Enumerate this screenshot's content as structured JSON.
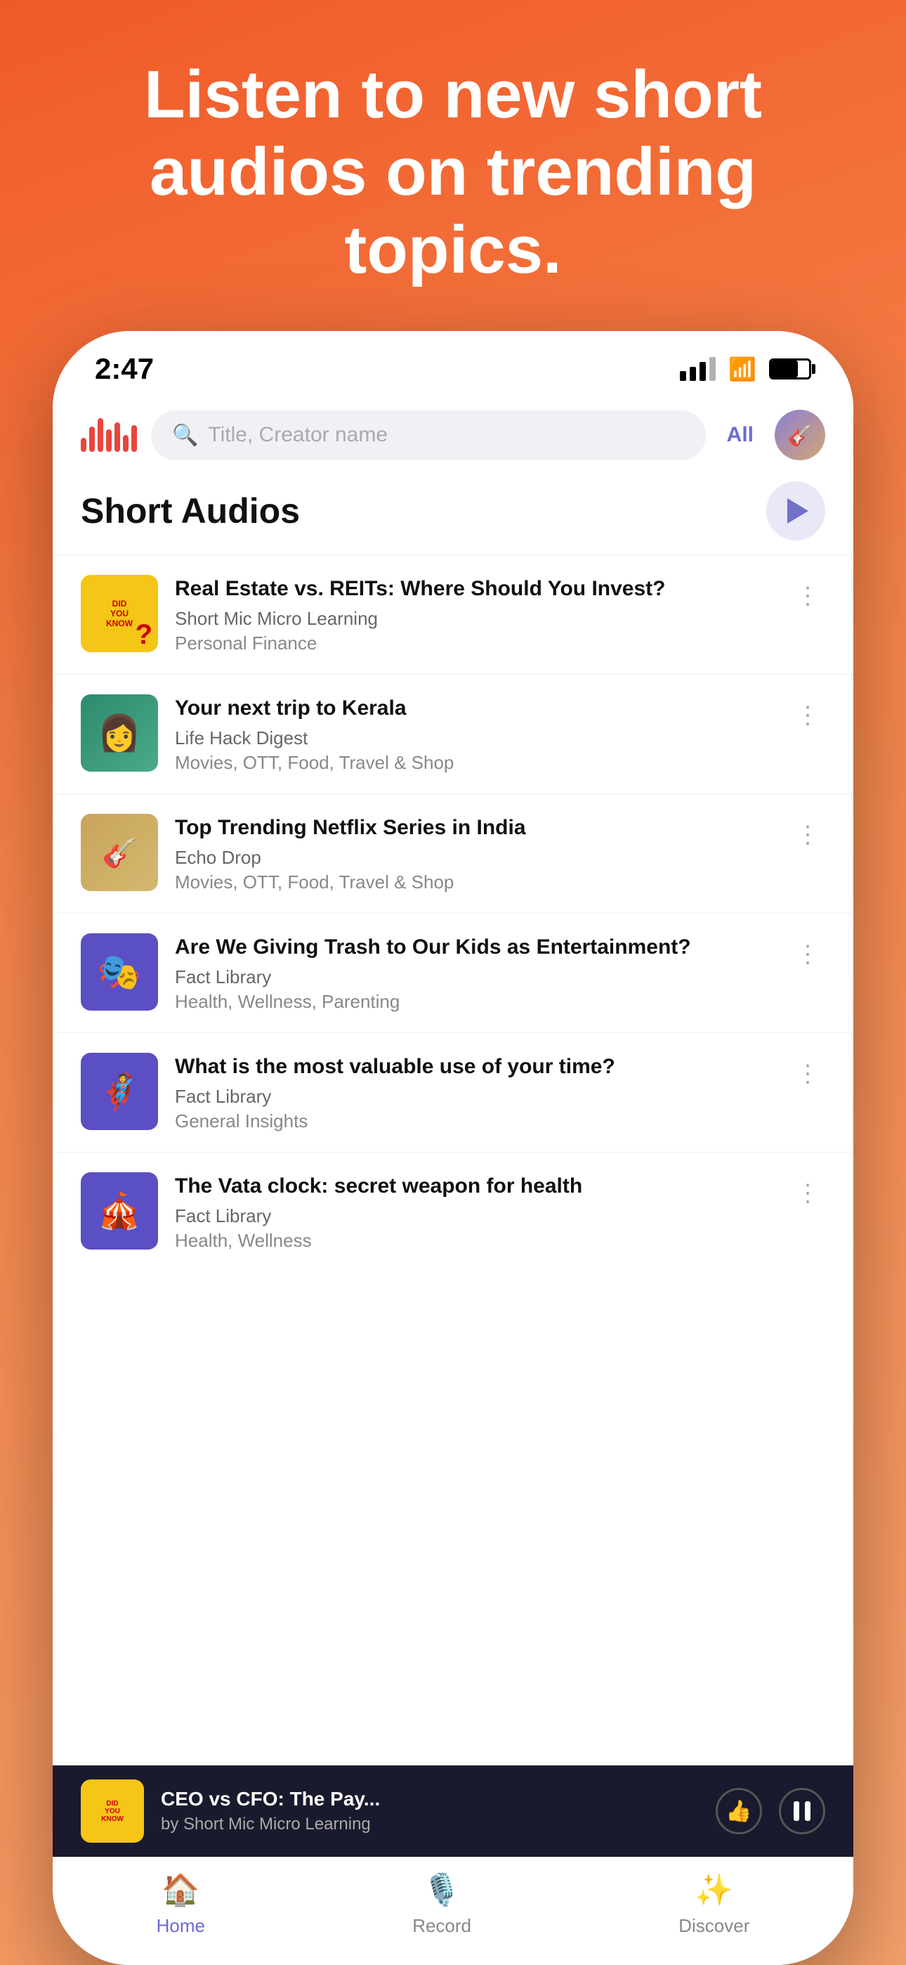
{
  "hero": {
    "title": "Listen to new short audios on trending topics."
  },
  "status_bar": {
    "time": "2:47",
    "battery_level": 70
  },
  "search": {
    "placeholder": "Title, Creator name",
    "filter_label": "All"
  },
  "section": {
    "title": "Short Audios"
  },
  "audio_items": [
    {
      "id": 1,
      "title": "Real Estate vs. REITs: Where Should You Invest?",
      "creator": "Short Mic Micro Learning",
      "category": "Personal Finance",
      "thumb_type": "dyk"
    },
    {
      "id": 2,
      "title": "Your next trip to Kerala",
      "creator": "Life Hack Digest",
      "category": "Movies, OTT, Food, Travel & Shop",
      "thumb_type": "kerala"
    },
    {
      "id": 3,
      "title": "Top Trending Netflix Series in India",
      "creator": "Echo Drop",
      "category": "Movies, OTT, Food, Travel & Shop",
      "thumb_type": "netflix"
    },
    {
      "id": 4,
      "title": "Are We Giving Trash to Our Kids as Entertainment?",
      "creator": "Fact Library",
      "category": "Health, Wellness, Parenting",
      "thumb_type": "kids"
    },
    {
      "id": 5,
      "title": "What is the most valuable use of your time?",
      "creator": "Fact Library",
      "category": "General Insights",
      "thumb_type": "time"
    },
    {
      "id": 6,
      "title": "The Vata clock: secret weapon for health",
      "creator": "Fact Library",
      "category": "Health, Wellness",
      "thumb_type": "vata"
    }
  ],
  "now_playing": {
    "title": "CEO vs CFO: The Pay...",
    "creator": "by Short Mic Micro Learning"
  },
  "bottom_nav": {
    "items": [
      {
        "label": "Home",
        "icon": "🏠",
        "active": true
      },
      {
        "label": "Record",
        "icon": "🎙️",
        "active": false
      },
      {
        "label": "Discover",
        "icon": "🔍",
        "active": false
      }
    ]
  }
}
